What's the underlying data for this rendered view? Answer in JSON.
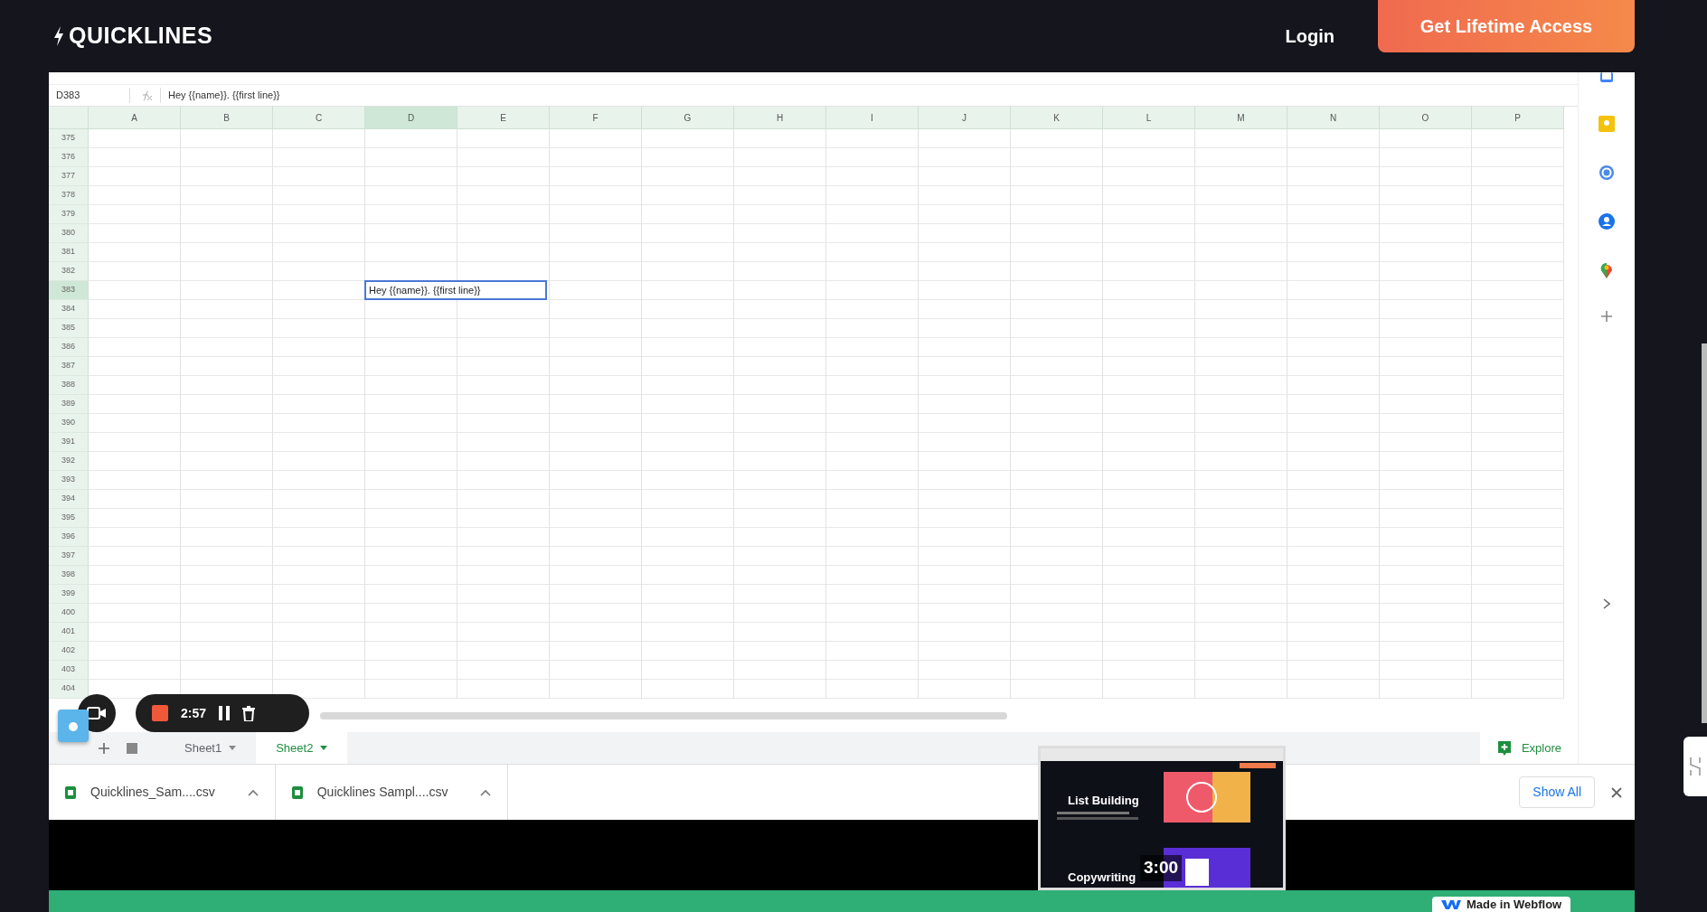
{
  "header": {
    "logo": "QUICKLINES",
    "login": "Login",
    "cta": "Get Lifetime Access"
  },
  "sheet": {
    "name_box": "D383",
    "formula": "Hey {{name}}. {{first line}}",
    "columns": [
      {
        "label": "A",
        "selected": false
      },
      {
        "label": "B",
        "selected": false
      },
      {
        "label": "C",
        "selected": false
      },
      {
        "label": "D",
        "selected": true
      },
      {
        "label": "E",
        "selected": false
      },
      {
        "label": "F",
        "selected": false
      },
      {
        "label": "G",
        "selected": false
      },
      {
        "label": "H",
        "selected": false
      },
      {
        "label": "I",
        "selected": false
      },
      {
        "label": "J",
        "selected": false
      },
      {
        "label": "K",
        "selected": false
      },
      {
        "label": "L",
        "selected": false
      },
      {
        "label": "M",
        "selected": false
      },
      {
        "label": "N",
        "selected": false
      },
      {
        "label": "O",
        "selected": false
      },
      {
        "label": "P",
        "selected": false
      }
    ],
    "rows": [
      {
        "label": "375",
        "selected": false
      },
      {
        "label": "376",
        "selected": false
      },
      {
        "label": "377",
        "selected": false
      },
      {
        "label": "378",
        "selected": false
      },
      {
        "label": "379",
        "selected": false
      },
      {
        "label": "380",
        "selected": false
      },
      {
        "label": "381",
        "selected": false
      },
      {
        "label": "382",
        "selected": false
      },
      {
        "label": "383",
        "selected": true
      },
      {
        "label": "384",
        "selected": false
      },
      {
        "label": "385",
        "selected": false
      },
      {
        "label": "386",
        "selected": false
      },
      {
        "label": "387",
        "selected": false
      },
      {
        "label": "388",
        "selected": false
      },
      {
        "label": "389",
        "selected": false
      },
      {
        "label": "390",
        "selected": false
      },
      {
        "label": "391",
        "selected": false
      },
      {
        "label": "392",
        "selected": false
      },
      {
        "label": "393",
        "selected": false
      },
      {
        "label": "394",
        "selected": false
      },
      {
        "label": "395",
        "selected": false
      },
      {
        "label": "396",
        "selected": false
      },
      {
        "label": "397",
        "selected": false
      },
      {
        "label": "398",
        "selected": false
      },
      {
        "label": "399",
        "selected": false
      },
      {
        "label": "400",
        "selected": false
      },
      {
        "label": "401",
        "selected": false
      },
      {
        "label": "402",
        "selected": false
      },
      {
        "label": "403",
        "selected": false
      },
      {
        "label": "404",
        "selected": false
      }
    ],
    "active_cell_text": "Hey {{name}}. {{first line}}",
    "tabs": [
      {
        "label": "Sheet1",
        "selected": false
      },
      {
        "label": "Sheet2",
        "selected": true
      }
    ],
    "explore": "Explore"
  },
  "recorder": {
    "time": "2:57"
  },
  "downloads": {
    "files": [
      "Quicklines_Sam....csv",
      "Quicklines Sampl....csv"
    ],
    "show_all": "Show All"
  },
  "preview": {
    "sections": [
      "List Building",
      "Copywriting"
    ],
    "time": "3:00"
  },
  "badge": "Made in Webflow"
}
